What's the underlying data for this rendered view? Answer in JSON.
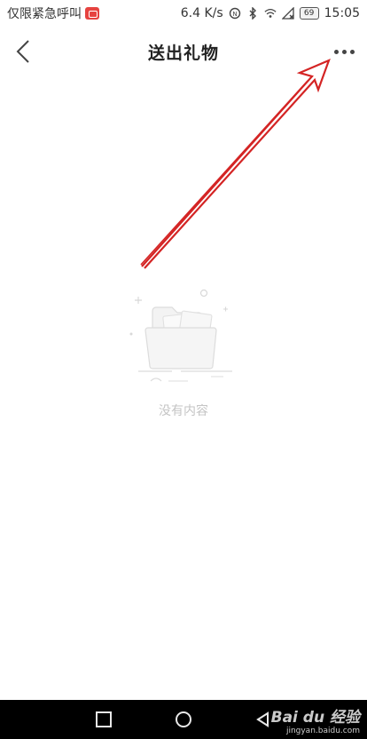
{
  "status_bar": {
    "carrier_text": "仅限紧急呼叫",
    "net_speed": "6.4 K/s",
    "battery_level": "69",
    "time": "15:05"
  },
  "nav": {
    "title": "送出礼物"
  },
  "empty_state": {
    "message": "没有内容"
  },
  "watermark": {
    "brand": "Bai du 经验",
    "url": "jingyan.baidu.com"
  },
  "colors": {
    "annotation": "#d42424",
    "empty_text": "#c4c4c4",
    "system_nav": "#000000"
  }
}
